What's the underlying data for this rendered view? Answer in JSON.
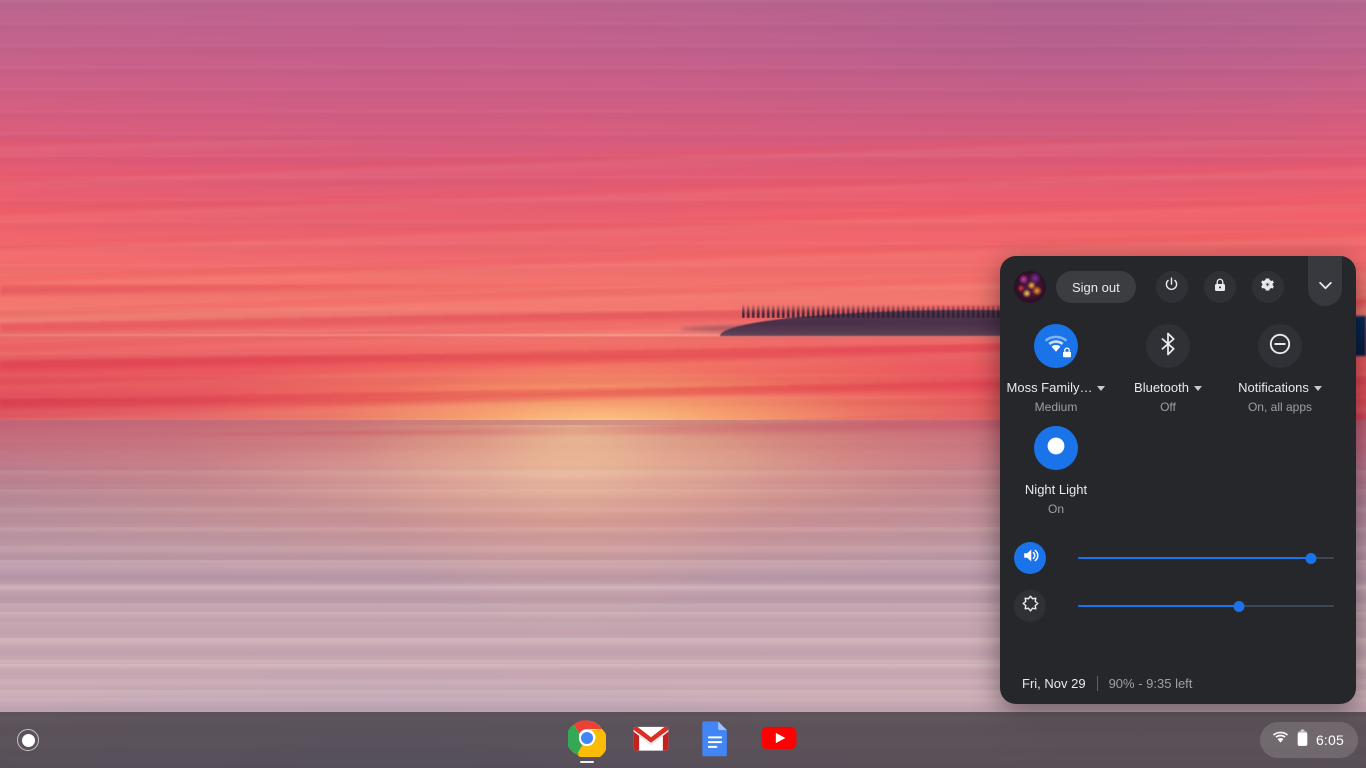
{
  "desktop": {
    "wallpaper_name": "sunset-over-water-wallpaper",
    "wallpaper_colors": {
      "sky_top": "#b9698f",
      "sky_mid": "#ef5f6b",
      "horizon_glow": "#ffd68c",
      "sea": "#c9a9b2",
      "island": "#3a2a44"
    }
  },
  "shelf": {
    "launcher": {
      "name": "launcher-button",
      "label": "Launcher"
    },
    "apps": [
      {
        "name": "shelf-app-chrome",
        "label": "Google Chrome",
        "active": true
      },
      {
        "name": "shelf-app-gmail",
        "label": "Gmail",
        "active": false
      },
      {
        "name": "shelf-app-docs",
        "label": "Google Docs",
        "active": false
      },
      {
        "name": "shelf-app-youtube",
        "label": "YouTube",
        "active": false
      }
    ],
    "status_tray": {
      "wifi_icon": "wifi-icon",
      "battery_icon": "battery-icon",
      "time": "6:05"
    }
  },
  "system_panel": {
    "header": {
      "avatar": "user-avatar",
      "sign_out_label": "Sign out",
      "power_icon": "power-icon",
      "lock_icon": "lock-icon",
      "settings_icon": "gear-icon",
      "collapse_icon": "chevron-down-icon"
    },
    "pods": [
      {
        "name": "network-pod",
        "icon": "wifi-locked-icon",
        "label": "Moss Family…",
        "sublabel": "Medium",
        "state": "on",
        "has_caret": true
      },
      {
        "name": "bluetooth-pod",
        "icon": "bluetooth-icon",
        "label": "Bluetooth",
        "sublabel": "Off",
        "state": "off",
        "has_caret": true
      },
      {
        "name": "notifications-pod",
        "icon": "do-not-disturb-icon",
        "label": "Notifications",
        "sublabel": "On, all apps",
        "state": "off",
        "has_caret": true
      },
      {
        "name": "night-light-pod",
        "icon": "moon-icon",
        "label": "Night Light",
        "sublabel": "On",
        "state": "on",
        "has_caret": false
      }
    ],
    "sliders": [
      {
        "name": "volume-slider",
        "icon": "volume-up-icon",
        "value": 91,
        "state": "on",
        "accent": "#1a73e8"
      },
      {
        "name": "brightness-slider",
        "icon": "brightness-icon",
        "value": 63,
        "state": "dim",
        "accent": "#1a73e8"
      }
    ],
    "footer": {
      "date": "Fri, Nov 29",
      "battery": "90% - 9:35 left"
    }
  }
}
